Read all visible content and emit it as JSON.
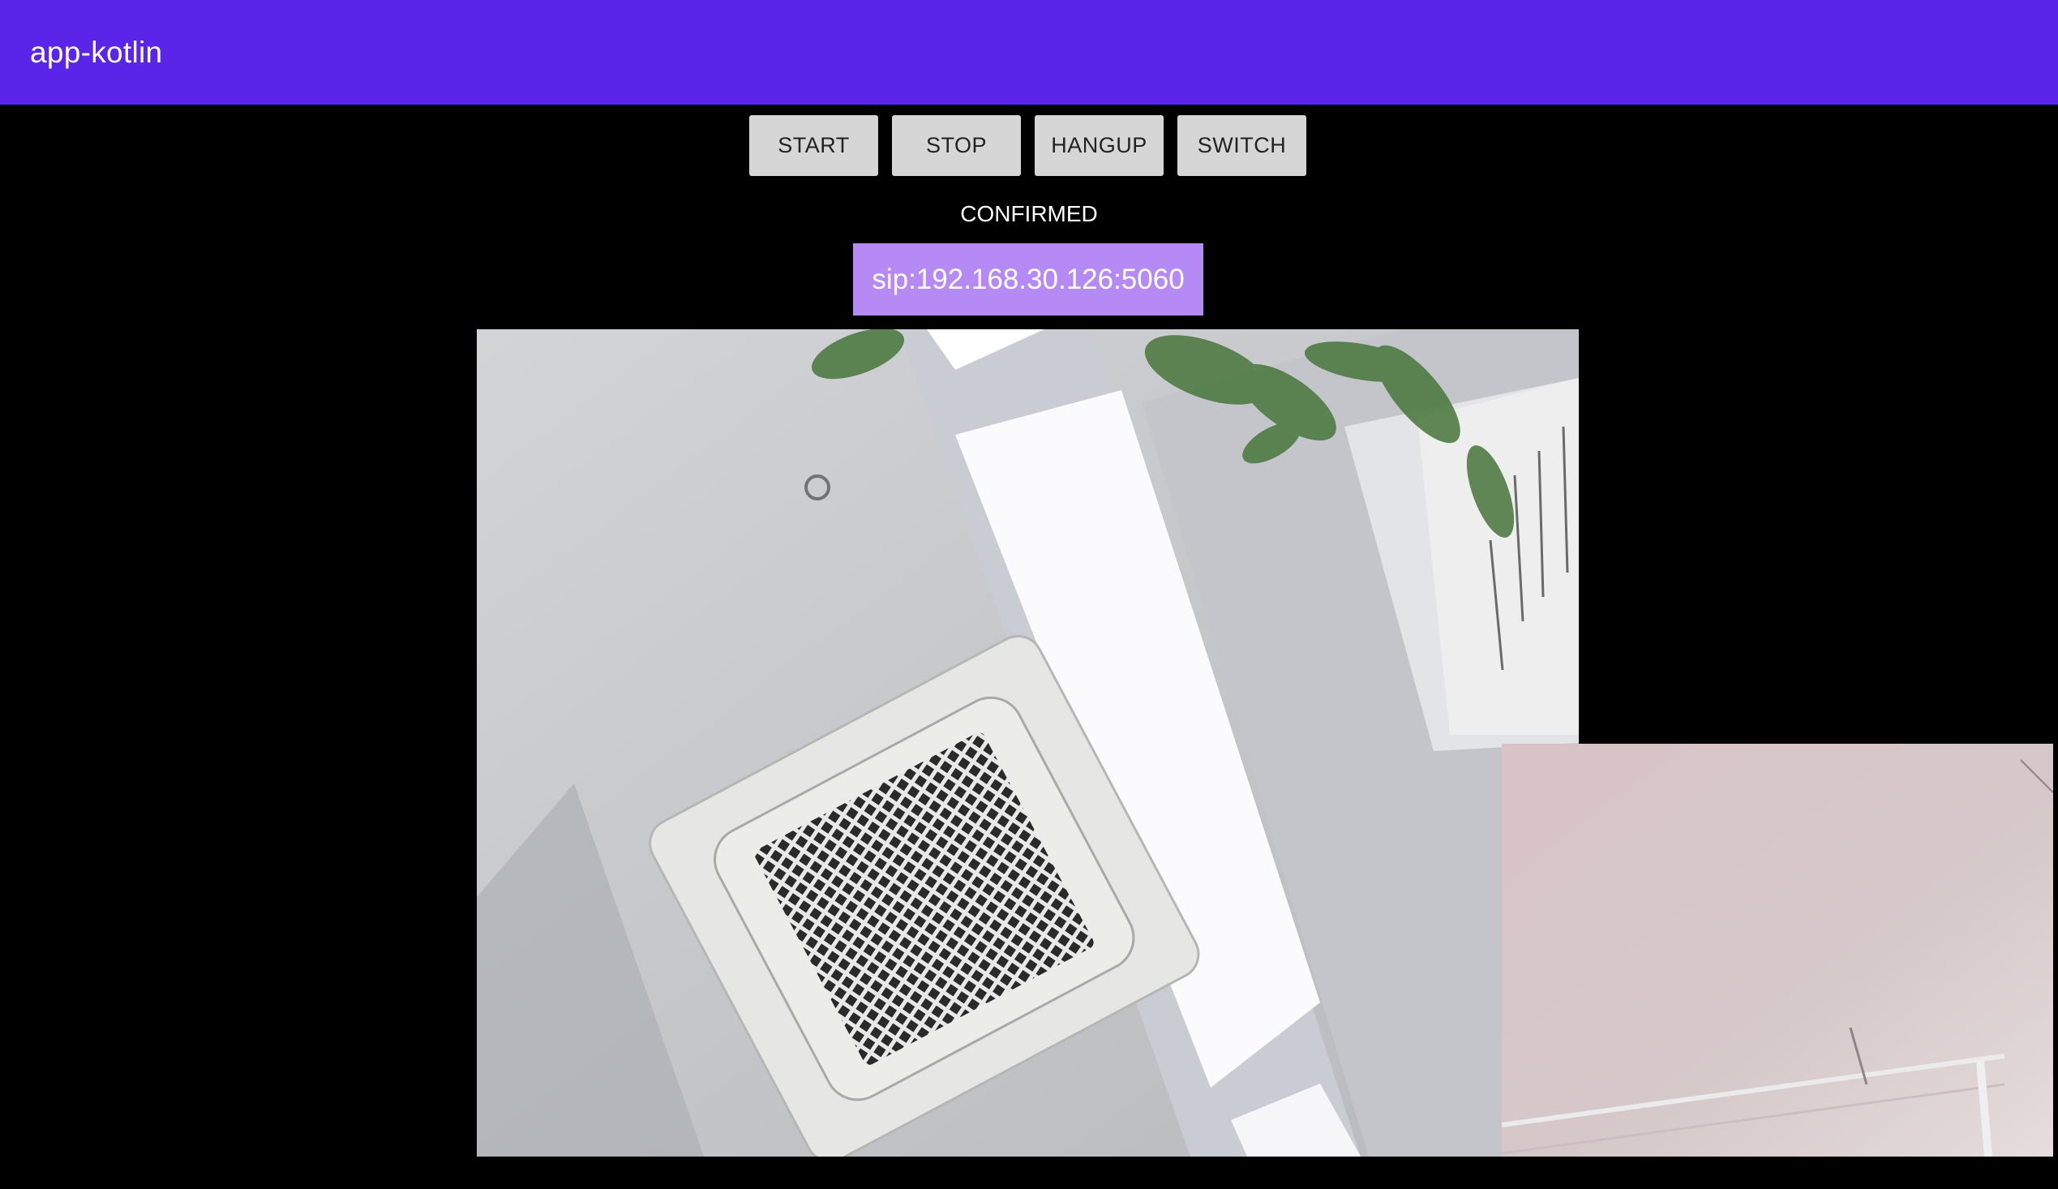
{
  "app": {
    "title": "app-kotlin",
    "colors": {
      "appbar": "#5a25e8",
      "background": "#000000",
      "button": "#d6d6d6",
      "sip_field": "#b68af4"
    }
  },
  "controls": {
    "start_label": "START",
    "stop_label": "STOP",
    "hangup_label": "HANGUP",
    "switch_label": "SWITCH"
  },
  "call": {
    "status": "CONFIRMED",
    "sip_address": "sip:192.168.30.126:5060"
  }
}
